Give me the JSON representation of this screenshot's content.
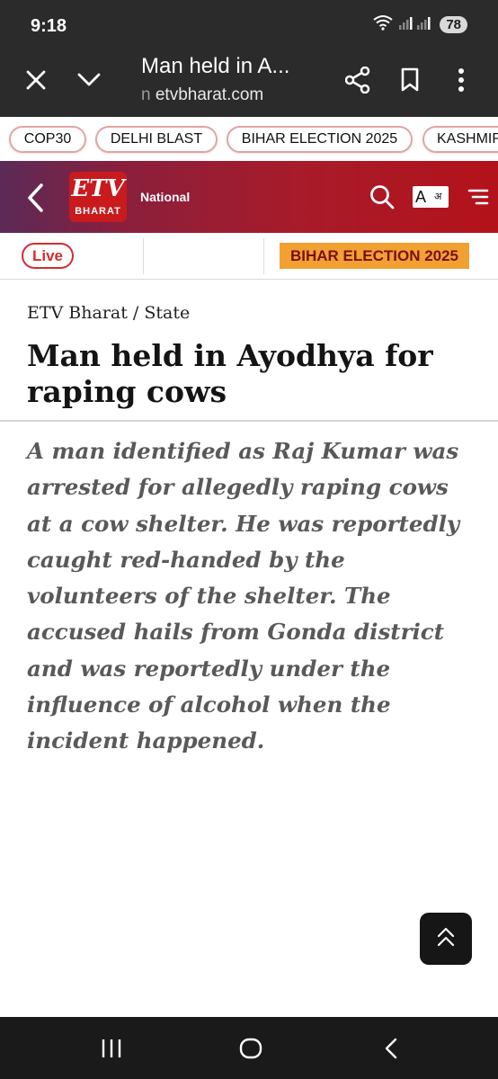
{
  "status_bar": {
    "time": "9:18",
    "battery": "78"
  },
  "browser": {
    "page_title": "Man held in A...",
    "url": "etvbharat.com",
    "url_prefix": "n"
  },
  "tags": [
    "COP30",
    "DELHI BLAST",
    "BIHAR ELECTION 2025",
    "KASHMIR"
  ],
  "site_header": {
    "logo_text": "ETV",
    "logo_sub": "BHARAT",
    "section": "National",
    "font_button_letter": "A",
    "font_button_sub": "अ"
  },
  "live_strip": {
    "live_label": "Live",
    "banner": "BIHAR ELECTION 2025"
  },
  "article": {
    "breadcrumb": "ETV Bharat / State",
    "headline": "Man held in Ayodhya for raping cows",
    "summary": "A man identified as Raj Kumar was arrested for allegedly raping cows at a cow shelter. He was reportedly caught red-handed by the volunteers of the shelter. The accused hails from Gonda district and was reportedly under the influence of alcohol when the incident happened."
  },
  "colors": {
    "browser_bg": "#2b2b2b",
    "header_red": "#b3121a",
    "banner_orange": "#f0a132",
    "live_red": "#d62b2b"
  },
  "icons": [
    "wifi-icon",
    "signal-icon",
    "close-icon",
    "chevron-down-icon",
    "share-icon",
    "bookmark-icon",
    "more-vert-icon",
    "back-arrow-icon",
    "search-icon",
    "font-size-icon",
    "menu-icon",
    "scroll-top-icon",
    "recents-icon",
    "home-icon",
    "nav-back-icon"
  ]
}
